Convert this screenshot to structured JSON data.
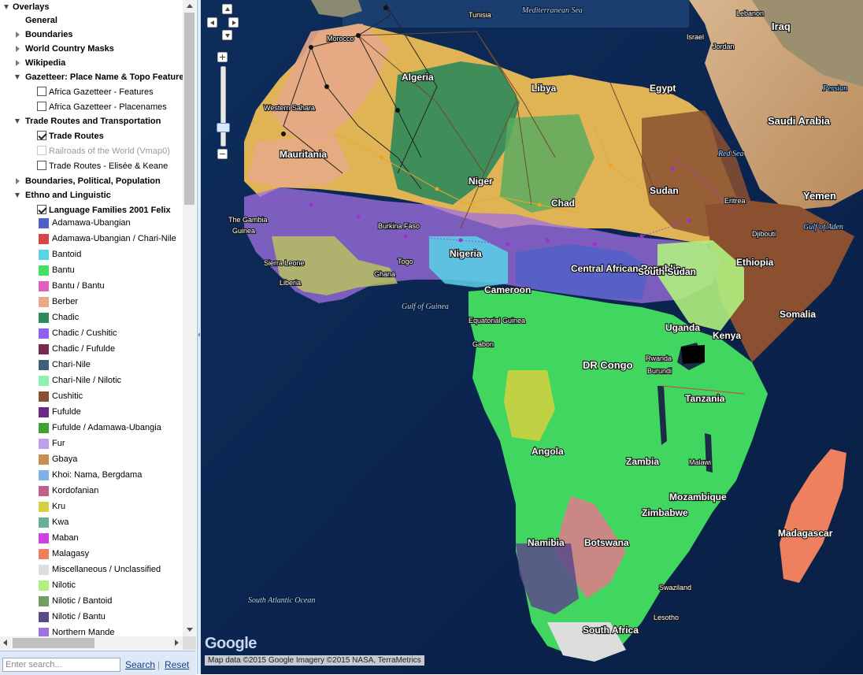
{
  "panel": {
    "title": "Overlays",
    "tree": [
      {
        "label": "General",
        "bold": true,
        "expander": "none",
        "indent": 32
      },
      {
        "label": "Boundaries",
        "bold": true,
        "expander": "closed",
        "indent": 32
      },
      {
        "label": "World Country Masks",
        "bold": true,
        "expander": "closed",
        "indent": 32
      },
      {
        "label": "Wikipedia",
        "bold": true,
        "expander": "closed",
        "indent": 32
      },
      {
        "label": "Gazetteer: Place Name & Topo Features",
        "bold": true,
        "expander": "open",
        "indent": 32
      },
      {
        "label": "Africa Gazetteer - Features",
        "checkbox": false,
        "indent": 62
      },
      {
        "label": "Africa Gazetteer - Placenames",
        "checkbox": false,
        "indent": 62
      },
      {
        "label": "Trade Routes and Transportation",
        "bold": true,
        "expander": "open",
        "indent": 32
      },
      {
        "label": "Trade Routes",
        "checkbox": true,
        "bold": true,
        "indent": 62
      },
      {
        "label": "Railroads of the World (Vmap0)",
        "checkbox": false,
        "disabled": true,
        "indent": 62
      },
      {
        "label": "Trade Routes - Elisée & Keane",
        "checkbox": false,
        "indent": 62
      },
      {
        "label": "Boundaries, Political, Population",
        "bold": true,
        "expander": "closed",
        "indent": 32
      },
      {
        "label": "Ethno and Linguistic",
        "bold": true,
        "expander": "open",
        "indent": 32
      },
      {
        "label": "Language Families 2001 Felix",
        "checkbox": true,
        "bold": true,
        "indent": 62
      }
    ],
    "legend": [
      {
        "label": "Adamawa-Ubangian",
        "color": "#5060c8"
      },
      {
        "label": "Adamawa-Ubangian / Chari-Nile",
        "color": "#d94545"
      },
      {
        "label": "Bantoid",
        "color": "#5ad2e8"
      },
      {
        "label": "Bantu",
        "color": "#45e060"
      },
      {
        "label": "Bantu / Bantu",
        "color": "#e060c0"
      },
      {
        "label": "Berber",
        "color": "#e8a88a"
      },
      {
        "label": "Chadic",
        "color": "#2e8a5a"
      },
      {
        "label": "Chadic / Cushitic",
        "color": "#9060ee"
      },
      {
        "label": "Chadic / Fufulde",
        "color": "#7a2850"
      },
      {
        "label": "Chari-Nile",
        "color": "#3e6078"
      },
      {
        "label": "Chari-Nile / Nilotic",
        "color": "#90f0b0"
      },
      {
        "label": "Cushitic",
        "color": "#8a5030"
      },
      {
        "label": "Fufulde",
        "color": "#6a2888"
      },
      {
        "label": "Fufulde / Adamawa-Ubangia",
        "color": "#40a030"
      },
      {
        "label": "Fur",
        "color": "#c0a0ec"
      },
      {
        "label": "Gbaya",
        "color": "#c89050"
      },
      {
        "label": "Khoi: Nama, Bergdama",
        "color": "#80b0e8"
      },
      {
        "label": "Kordofanian",
        "color": "#c06088"
      },
      {
        "label": "Kru",
        "color": "#d8d040"
      },
      {
        "label": "Kwa",
        "color": "#6ab098"
      },
      {
        "label": "Maban",
        "color": "#d040e0"
      },
      {
        "label": "Malagasy",
        "color": "#ee8060"
      },
      {
        "label": "Miscellaneous / Unclassified",
        "color": "#dddddd"
      },
      {
        "label": "Nilotic",
        "color": "#b0f080"
      },
      {
        "label": "Nilotic / Bantoid",
        "color": "#70a060"
      },
      {
        "label": "Nilotic / Bantu",
        "color": "#5a4a8a"
      },
      {
        "label": "Northern Mande",
        "color": "#a070e0"
      }
    ],
    "search": {
      "placeholder": "Enter search...",
      "search_label": "Search",
      "reset_label": "Reset"
    }
  },
  "map": {
    "attribution": "Map data ©2015 Google Imagery ©2015 NASA, TerraMetrics",
    "logo": "Google",
    "labels": [
      {
        "text": "Mediterranean Sea",
        "kind": "ocean"
      },
      {
        "text": "Lebanon",
        "kind": "land"
      },
      {
        "text": "Iraq",
        "kind": "landbig"
      },
      {
        "text": "Israel",
        "kind": "land"
      },
      {
        "text": "Jordan",
        "kind": "land"
      },
      {
        "text": "Persian",
        "kind": "ocean"
      },
      {
        "text": "Saudi Arabia",
        "kind": "landbig"
      },
      {
        "text": "Libya",
        "kind": "landmid"
      },
      {
        "text": "Egypt",
        "kind": "landmid"
      },
      {
        "text": "Algeria",
        "kind": "landmid"
      },
      {
        "text": "Western Sahara",
        "kind": "land"
      },
      {
        "text": "Mauritania",
        "kind": "landmid"
      },
      {
        "text": "Red Sea",
        "kind": "ocean"
      },
      {
        "text": "Yemen",
        "kind": "landbig"
      },
      {
        "text": "Gulf of Aden",
        "kind": "ocean"
      },
      {
        "text": "Niger",
        "kind": "landmid"
      },
      {
        "text": "Chad",
        "kind": "landmid"
      },
      {
        "text": "Sudan",
        "kind": "landmid"
      },
      {
        "text": "Eritrea",
        "kind": "land"
      },
      {
        "text": "Djibouti",
        "kind": "land"
      },
      {
        "text": "The Gambia",
        "kind": "land"
      },
      {
        "text": "Guinea",
        "kind": "land"
      },
      {
        "text": "Burkina Faso",
        "kind": "land"
      },
      {
        "text": "Sierra Leone",
        "kind": "land"
      },
      {
        "text": "Liberia",
        "kind": "land"
      },
      {
        "text": "Ghana",
        "kind": "land"
      },
      {
        "text": "Togo",
        "kind": "land"
      },
      {
        "text": "Nigeria",
        "kind": "landmid"
      },
      {
        "text": "Central African Republic",
        "kind": "landmid"
      },
      {
        "text": "South Sudan",
        "kind": "landmid"
      },
      {
        "text": "Ethiopia",
        "kind": "landmid"
      },
      {
        "text": "Somalia",
        "kind": "landmid"
      },
      {
        "text": "Cameroon",
        "kind": "landmid"
      },
      {
        "text": "Gulf of Guinea",
        "kind": "ocean"
      },
      {
        "text": "Equatorial Guinea",
        "kind": "land"
      },
      {
        "text": "Gabon",
        "kind": "land"
      },
      {
        "text": "Uganda",
        "kind": "landmid"
      },
      {
        "text": "Kenya",
        "kind": "landmid"
      },
      {
        "text": "DR Congo",
        "kind": "landbig"
      },
      {
        "text": "Rwanda",
        "kind": "land"
      },
      {
        "text": "Burundi",
        "kind": "land"
      },
      {
        "text": "Tanzania",
        "kind": "landmid"
      },
      {
        "text": "Angola",
        "kind": "landmid"
      },
      {
        "text": "Zambia",
        "kind": "landmid"
      },
      {
        "text": "Malawi",
        "kind": "land"
      },
      {
        "text": "Mozambique",
        "kind": "landmid"
      },
      {
        "text": "Zimbabwe",
        "kind": "landmid"
      },
      {
        "text": "Madagascar",
        "kind": "landmid"
      },
      {
        "text": "Namibia",
        "kind": "landmid"
      },
      {
        "text": "Botswana",
        "kind": "landmid"
      },
      {
        "text": "Swaziland",
        "kind": "land"
      },
      {
        "text": "Lesotho",
        "kind": "land"
      },
      {
        "text": "South Africa",
        "kind": "landmid"
      },
      {
        "text": "South Atlantic Ocean",
        "kind": "ocean"
      },
      {
        "text": "Tunisia",
        "kind": "land"
      },
      {
        "text": "Morocco",
        "kind": "land"
      }
    ]
  }
}
